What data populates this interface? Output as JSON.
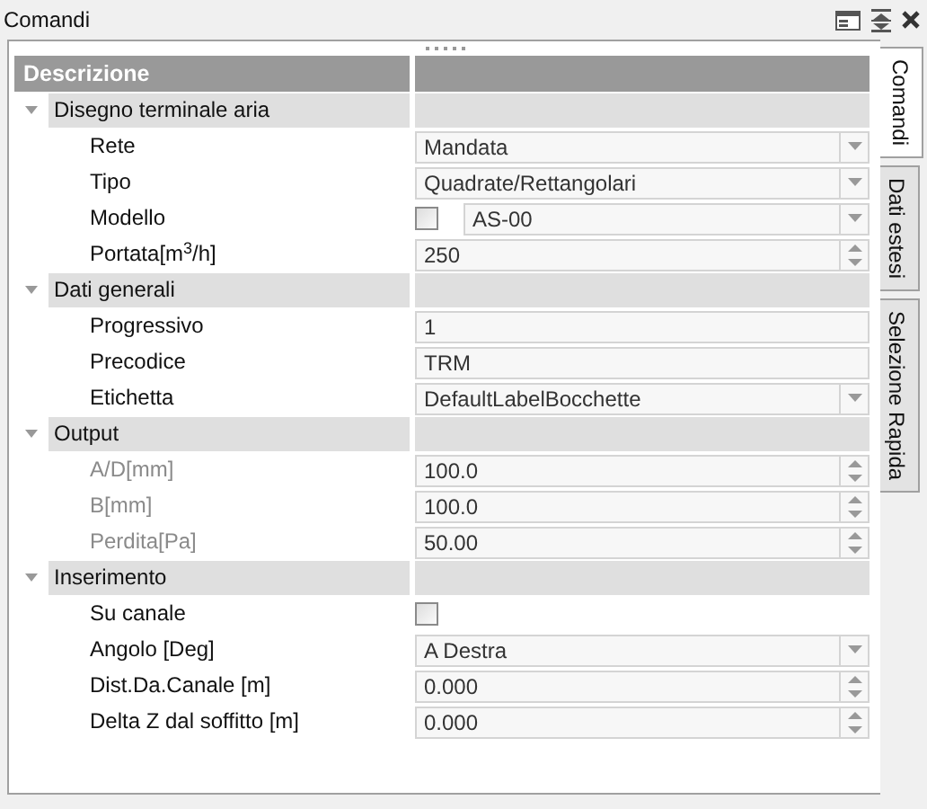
{
  "panel": {
    "title": "Comandi"
  },
  "grid": {
    "columns": [
      "Descrizione"
    ],
    "categories": [
      {
        "label": "Disegno terminale aria",
        "expanded": true,
        "properties": [
          {
            "label": "Rete",
            "kind": "dropdown",
            "value": "Mandata",
            "disabled": false
          },
          {
            "label": "Tipo",
            "kind": "dropdown",
            "value": "Quadrate/Rettangolari",
            "disabled": false
          },
          {
            "label": "Modello",
            "kind": "check_dropdown",
            "checked": false,
            "value": "AS-00",
            "disabled": false
          },
          {
            "label": "Portata[m$^{3}$/h]",
            "kind": "spin",
            "value": "250",
            "disabled": false
          }
        ]
      },
      {
        "label": "Dati generali",
        "expanded": true,
        "properties": [
          {
            "label": "Progressivo",
            "kind": "text",
            "value": "1",
            "disabled": false
          },
          {
            "label": "Precodice",
            "kind": "text",
            "value": "TRM",
            "disabled": false
          },
          {
            "label": "Etichetta",
            "kind": "dropdown",
            "value": "DefaultLabelBocchette",
            "disabled": false
          }
        ]
      },
      {
        "label": "Output",
        "expanded": true,
        "properties": [
          {
            "label": "A/D[mm]",
            "kind": "spin",
            "value": "100.0",
            "disabled": true
          },
          {
            "label": "B[mm]",
            "kind": "spin",
            "value": "100.0",
            "disabled": true
          },
          {
            "label": "Perdita[Pa]",
            "kind": "spin",
            "value": "50.00",
            "disabled": true
          }
        ]
      },
      {
        "label": "Inserimento",
        "expanded": true,
        "properties": [
          {
            "label": "Su canale",
            "kind": "checkbox",
            "checked": false,
            "disabled": false
          },
          {
            "label": "Angolo [Deg]",
            "kind": "dropdown",
            "value": "A Destra",
            "disabled": false
          },
          {
            "label": "Dist.Da.Canale [m]",
            "kind": "spin",
            "value": "0.000",
            "disabled": false
          },
          {
            "label": "Delta Z dal soffitto [m]",
            "kind": "spin",
            "value": "0.000",
            "disabled": false
          }
        ]
      }
    ]
  },
  "side_tabs": [
    {
      "label": "Comandi",
      "selected": true
    },
    {
      "label": "Dati estesi",
      "selected": false
    },
    {
      "label": "Selezione Rapida",
      "selected": false
    }
  ]
}
